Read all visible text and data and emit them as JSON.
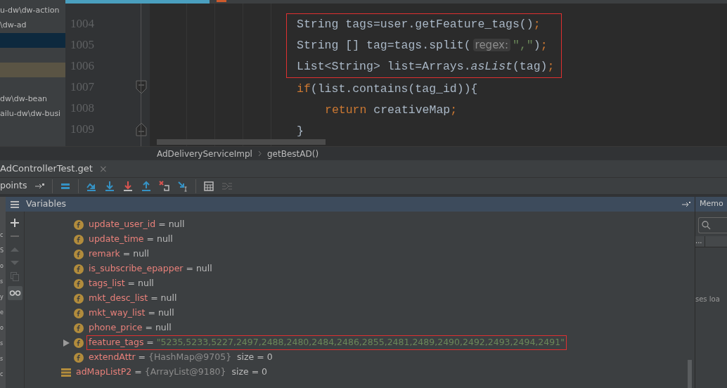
{
  "editor_tabs": [
    {
      "selected": true
    },
    {
      "selected": false
    }
  ],
  "project_tree": [
    {
      "label": "u-dw\\dw-action",
      "selected": false,
      "highlighted": false
    },
    {
      "label": "\\dw-ad",
      "selected": false,
      "highlighted": false
    },
    {
      "selected": true,
      "highlighted": false
    },
    {
      "selected": false,
      "highlighted": false
    },
    {
      "selected": false,
      "highlighted": true
    },
    {
      "selected": false,
      "highlighted": false
    },
    {
      "label": "dw\\dw-bean",
      "selected": false,
      "highlighted": false
    },
    {
      "label": "ailu-dw\\dw-busi",
      "selected": false,
      "highlighted": false
    }
  ],
  "editor": {
    "lines": [
      {
        "number": "1004",
        "kind": "code",
        "marked": true,
        "tokens": [
          {
            "kind": "plain",
            "text": "String tags=user.getFeature_tags()"
          },
          {
            "kind": "keyword",
            "text": ";"
          }
        ]
      },
      {
        "number": "1005",
        "kind": "code",
        "marked": true,
        "tokens": [
          {
            "kind": "plain",
            "text": "String [] tag=tags.split("
          },
          {
            "kind": "hint",
            "text": "regex:"
          },
          {
            "kind": "string",
            "text": "\",\""
          },
          {
            "kind": "plain",
            "text": ")"
          },
          {
            "kind": "keyword",
            "text": ";"
          }
        ]
      },
      {
        "number": "1006",
        "kind": "code",
        "marked": true,
        "tokens": [
          {
            "kind": "plain",
            "text": "List<String> list=Arrays."
          },
          {
            "kind": "italic",
            "text": "asList"
          },
          {
            "kind": "plain",
            "text": "(tag)"
          },
          {
            "kind": "keyword",
            "text": ";"
          }
        ]
      },
      {
        "number": "1007",
        "kind": "block_start",
        "marked": false,
        "tokens": [
          {
            "kind": "keyword",
            "text": "if"
          },
          {
            "kind": "plain",
            "text": "(list.contains(tag_id)){"
          }
        ],
        "children": [
          {
            "number": "1008",
            "kind": "code",
            "marked": false,
            "tokens": [
              {
                "kind": "keyword",
                "text": "return "
              },
              {
                "kind": "plain",
                "text": "creativeMap"
              },
              {
                "kind": "keyword",
                "text": ";"
              }
            ]
          }
        ]
      },
      {
        "number": "1009",
        "kind": "block_end",
        "marked": false,
        "tokens": [
          {
            "kind": "plain",
            "text": "}"
          }
        ]
      }
    ]
  },
  "breadcrumbs": [
    "AdDeliveryServiceImpl",
    "getBestAD()"
  ],
  "debug_tab": {
    "label": "AdControllerTest.get",
    "close": "×"
  },
  "toolbar": {
    "label": "points"
  },
  "frames": [
    "c",
    "S",
    "o",
    "s",
    "y",
    "e",
    "o",
    "s",
    "s",
    "c"
  ],
  "variables": {
    "title": "Variables",
    "rows": [
      {
        "kind": "field",
        "name": "update_user_id",
        "operator": "=",
        "value": {
          "kind": "plain",
          "text": "null"
        },
        "expandable": false,
        "marked": false
      },
      {
        "kind": "field",
        "name": "update_time",
        "operator": "=",
        "value": {
          "kind": "plain",
          "text": "null"
        },
        "expandable": false,
        "marked": false
      },
      {
        "kind": "field",
        "name": "remark",
        "operator": "=",
        "value": {
          "kind": "plain",
          "text": "null"
        },
        "expandable": false,
        "marked": false
      },
      {
        "kind": "field",
        "name": "is_subscribe_epapper",
        "operator": "=",
        "value": {
          "kind": "plain",
          "text": "null"
        },
        "expandable": false,
        "marked": false
      },
      {
        "kind": "field",
        "name": "tags_list",
        "operator": "=",
        "value": {
          "kind": "plain",
          "text": "null"
        },
        "expandable": false,
        "marked": false
      },
      {
        "kind": "field",
        "name": "mkt_desc_list",
        "operator": "=",
        "value": {
          "kind": "plain",
          "text": "null"
        },
        "expandable": false,
        "marked": false
      },
      {
        "kind": "field",
        "name": "mkt_way_list",
        "operator": "=",
        "value": {
          "kind": "plain",
          "text": "null"
        },
        "expandable": false,
        "marked": false
      },
      {
        "kind": "field",
        "name": "phone_price",
        "operator": "=",
        "value": {
          "kind": "plain",
          "text": "null"
        },
        "expandable": false,
        "marked": false
      },
      {
        "kind": "field",
        "name": "feature_tags",
        "operator": "=",
        "value": {
          "kind": "string",
          "text": "\"5235,5233,5227,2497,2488,2480,2484,2486,2855,2481,2489,2490,2492,2493,2494,2491\""
        },
        "expandable": true,
        "marked": true
      },
      {
        "kind": "field",
        "name": "extendAttr",
        "operator": "=",
        "value": {
          "kind": "object",
          "text": "{HashMap@9705}"
        },
        "size": "size = 0",
        "expandable": false,
        "marked": false
      },
      {
        "kind": "local",
        "name": "adMapListP2",
        "operator": "=",
        "value": {
          "kind": "object",
          "text": "{ArrayList@9180}"
        },
        "size": "size = 0",
        "expandable": false,
        "marked": false
      }
    ]
  },
  "memory": {
    "title": "Memo",
    "column": "...",
    "text": "ses loa"
  }
}
